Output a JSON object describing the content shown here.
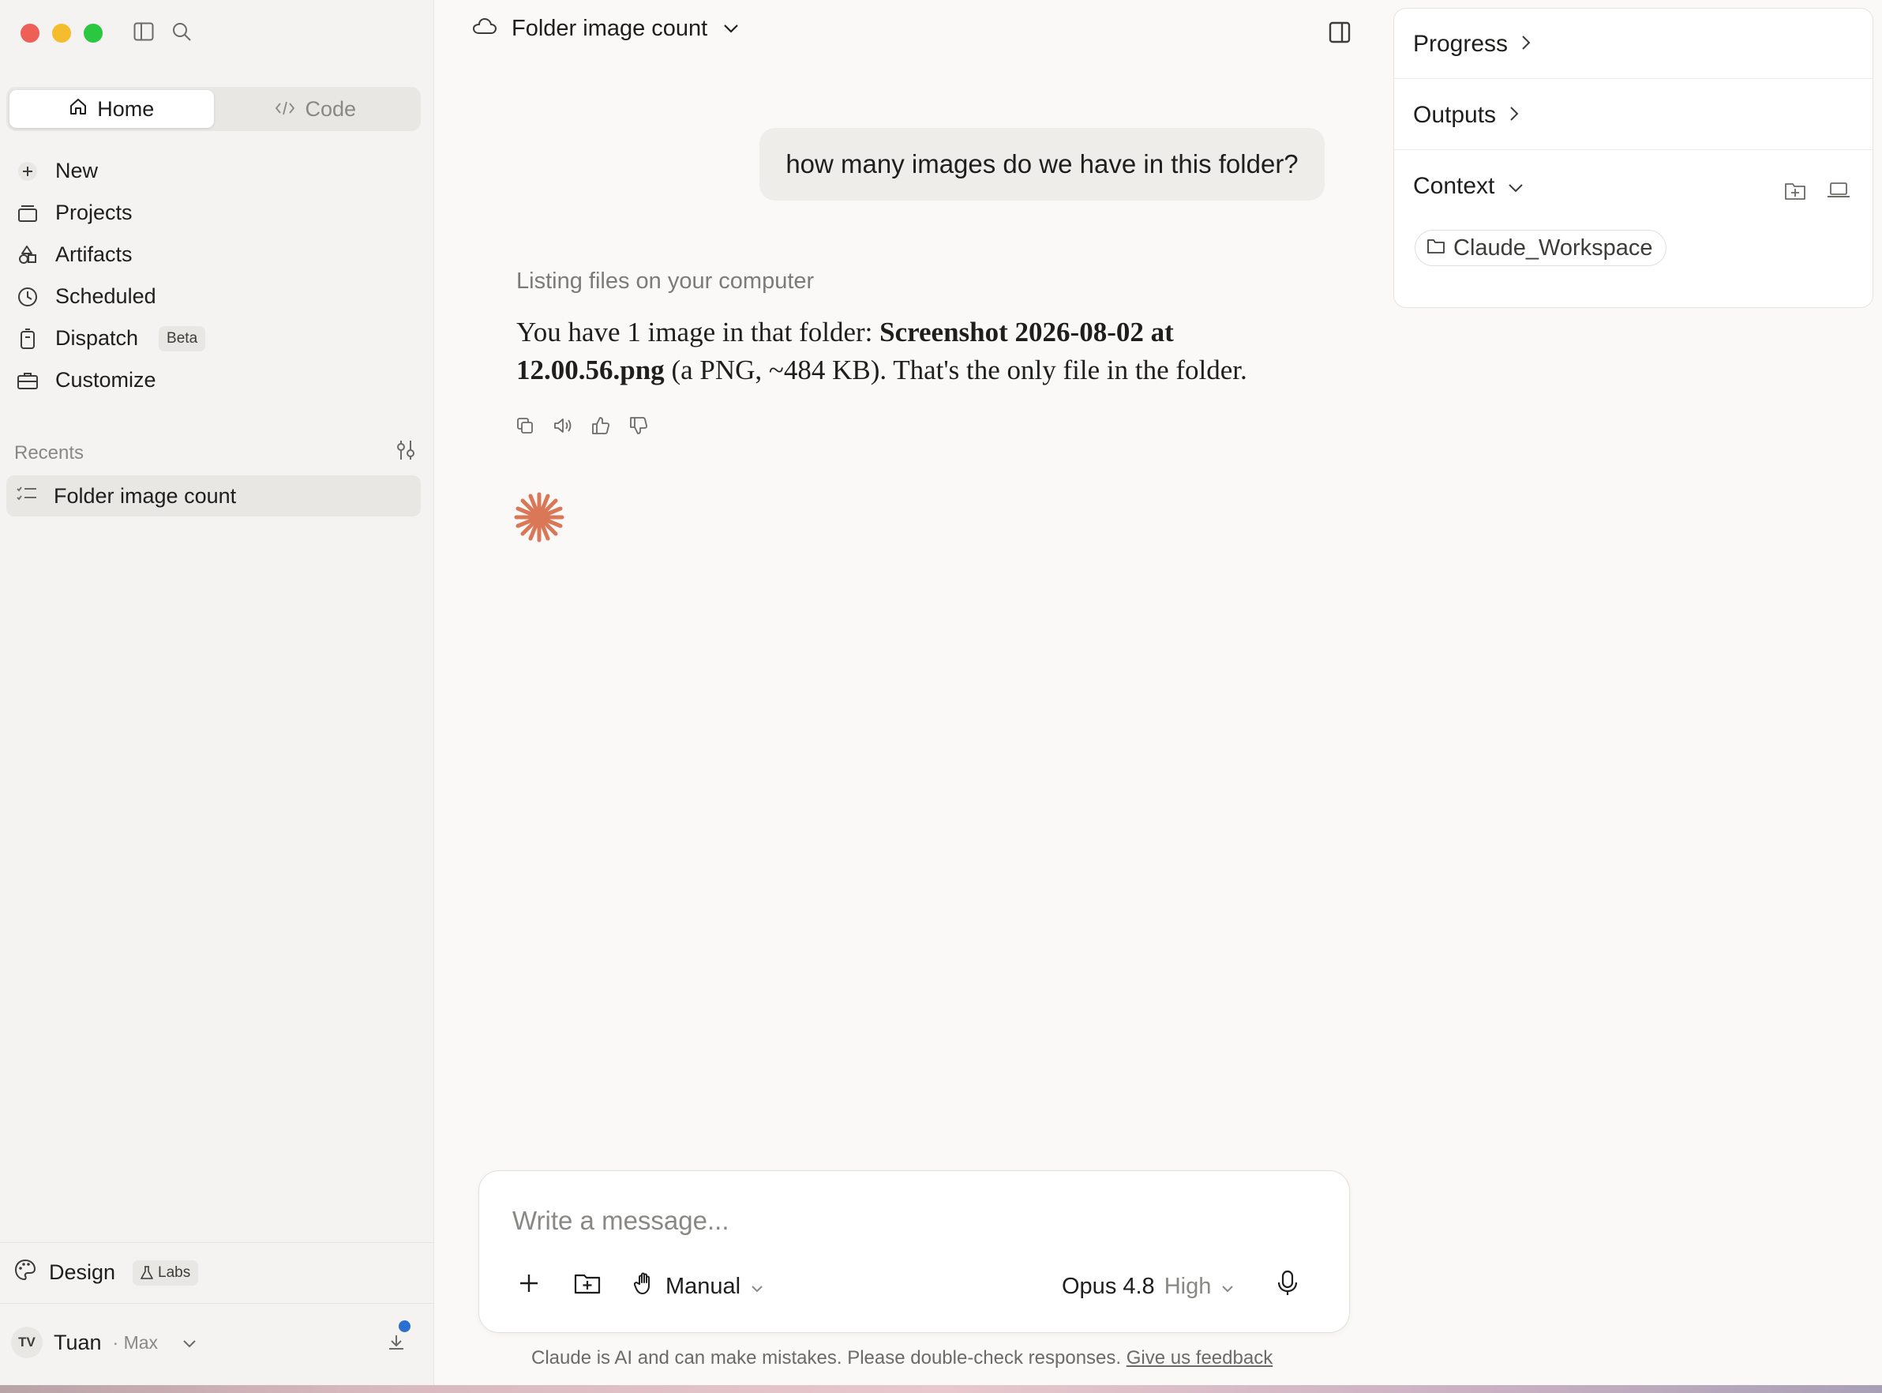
{
  "sidebar": {
    "tabs": [
      {
        "label": "Home",
        "active": true
      },
      {
        "label": "Code",
        "active": false
      }
    ],
    "nav": [
      {
        "label": "New",
        "icon": "plus-icon"
      },
      {
        "label": "Projects",
        "icon": "projects-icon"
      },
      {
        "label": "Artifacts",
        "icon": "artifacts-icon"
      },
      {
        "label": "Scheduled",
        "icon": "clock-icon"
      },
      {
        "label": "Dispatch",
        "icon": "dispatch-icon",
        "badge": "Beta"
      },
      {
        "label": "Customize",
        "icon": "briefcase-icon"
      }
    ],
    "recents_label": "Recents",
    "recents": [
      {
        "label": "Folder image count",
        "active": true
      }
    ],
    "design_label": "Design",
    "design_badge": "Labs",
    "user": {
      "initials": "TV",
      "name": "Tuan",
      "plan": "· Max"
    }
  },
  "chat": {
    "title": "Folder image count",
    "user_message": "how many images do we have in this folder?",
    "tool_status": "Listing files on your computer",
    "answer": {
      "prefix": "You have 1 image in that folder: ",
      "filename": "Screenshot 2026-08-02 at 12.00.56.png",
      "suffix": " (a PNG, ~484 KB). That's the only file in the folder."
    }
  },
  "composer": {
    "placeholder": "Write a message...",
    "mode": "Manual",
    "model": "Opus 4.8",
    "effort": "High"
  },
  "disclaimer": {
    "text": "Claude is AI and can make mistakes. Please double-check responses. ",
    "link": "Give us feedback"
  },
  "right_panel": {
    "progress": "Progress",
    "outputs": "Outputs",
    "context": "Context",
    "folder_chip": "Claude_Workspace"
  },
  "colors": {
    "accent_spark": "#d97757",
    "notification_dot": "#2b6fd1"
  }
}
